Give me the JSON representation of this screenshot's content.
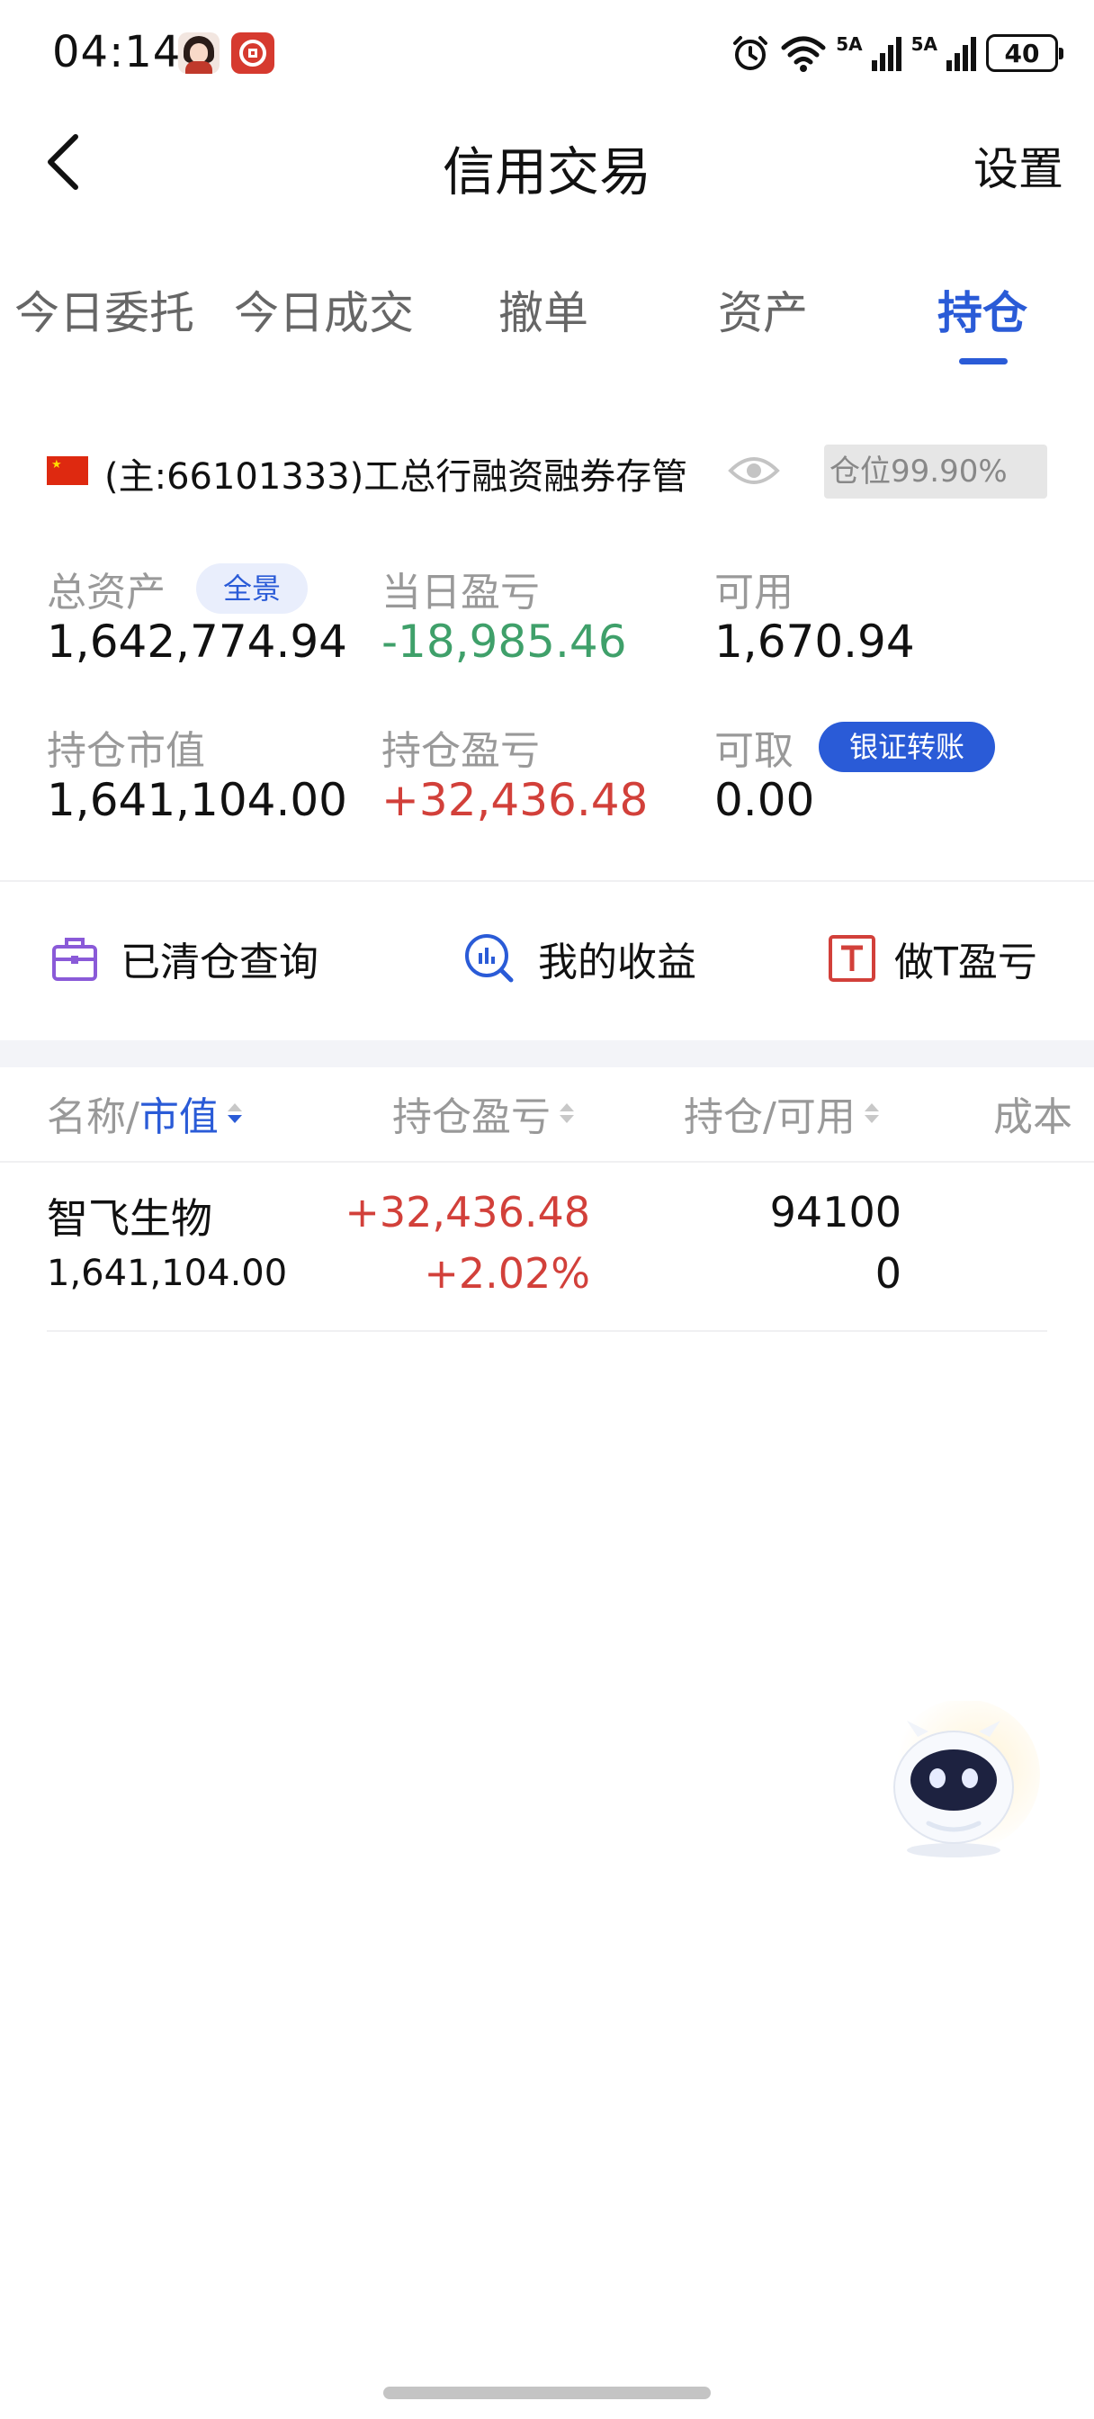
{
  "status_bar": {
    "time": "04:14",
    "network_1": "5A",
    "network_2": "5A",
    "battery": "40"
  },
  "nav": {
    "title": "信用交易",
    "settings_label": "设置"
  },
  "tabs": [
    {
      "label": "今日委托"
    },
    {
      "label": "今日成交"
    },
    {
      "label": "撤单"
    },
    {
      "label": "资产"
    },
    {
      "label": "持仓",
      "active": true
    }
  ],
  "account": {
    "name": "(主:66101333)工总行融资融券存管",
    "position_label": "仓位99.90%"
  },
  "summary": {
    "total_assets_label": "总资产",
    "panorama_label": "全景",
    "total_assets": "1,642,774.94",
    "daily_pnl_label": "当日盈亏",
    "daily_pnl": "-18,985.46",
    "available_label": "可用",
    "available": "1,670.94",
    "market_value_label": "持仓市值",
    "market_value": "1,641,104.00",
    "position_pnl_label": "持仓盈亏",
    "position_pnl": "+32,436.48",
    "withdrawable_label": "可取",
    "transfer_label": "银证转账",
    "withdrawable": "0.00"
  },
  "quick_actions": {
    "cleared_label": "已清仓查询",
    "income_label": "我的收益",
    "t_label": "做T盈亏"
  },
  "table": {
    "col_name": "名称/",
    "col_value": "市值",
    "col_pnl": "持仓盈亏",
    "col_holding": "持仓/可用",
    "col_cost": "成本"
  },
  "holdings": [
    {
      "name": "智飞生物",
      "market_value": "1,641,104.00",
      "pnl": "+32,436.48",
      "pnl_pct": "+2.02%",
      "quantity": "94100",
      "available": "0"
    }
  ],
  "colors": {
    "accent": "#2a5bd7",
    "gain": "#d2403a",
    "loss": "#3fa06a"
  }
}
